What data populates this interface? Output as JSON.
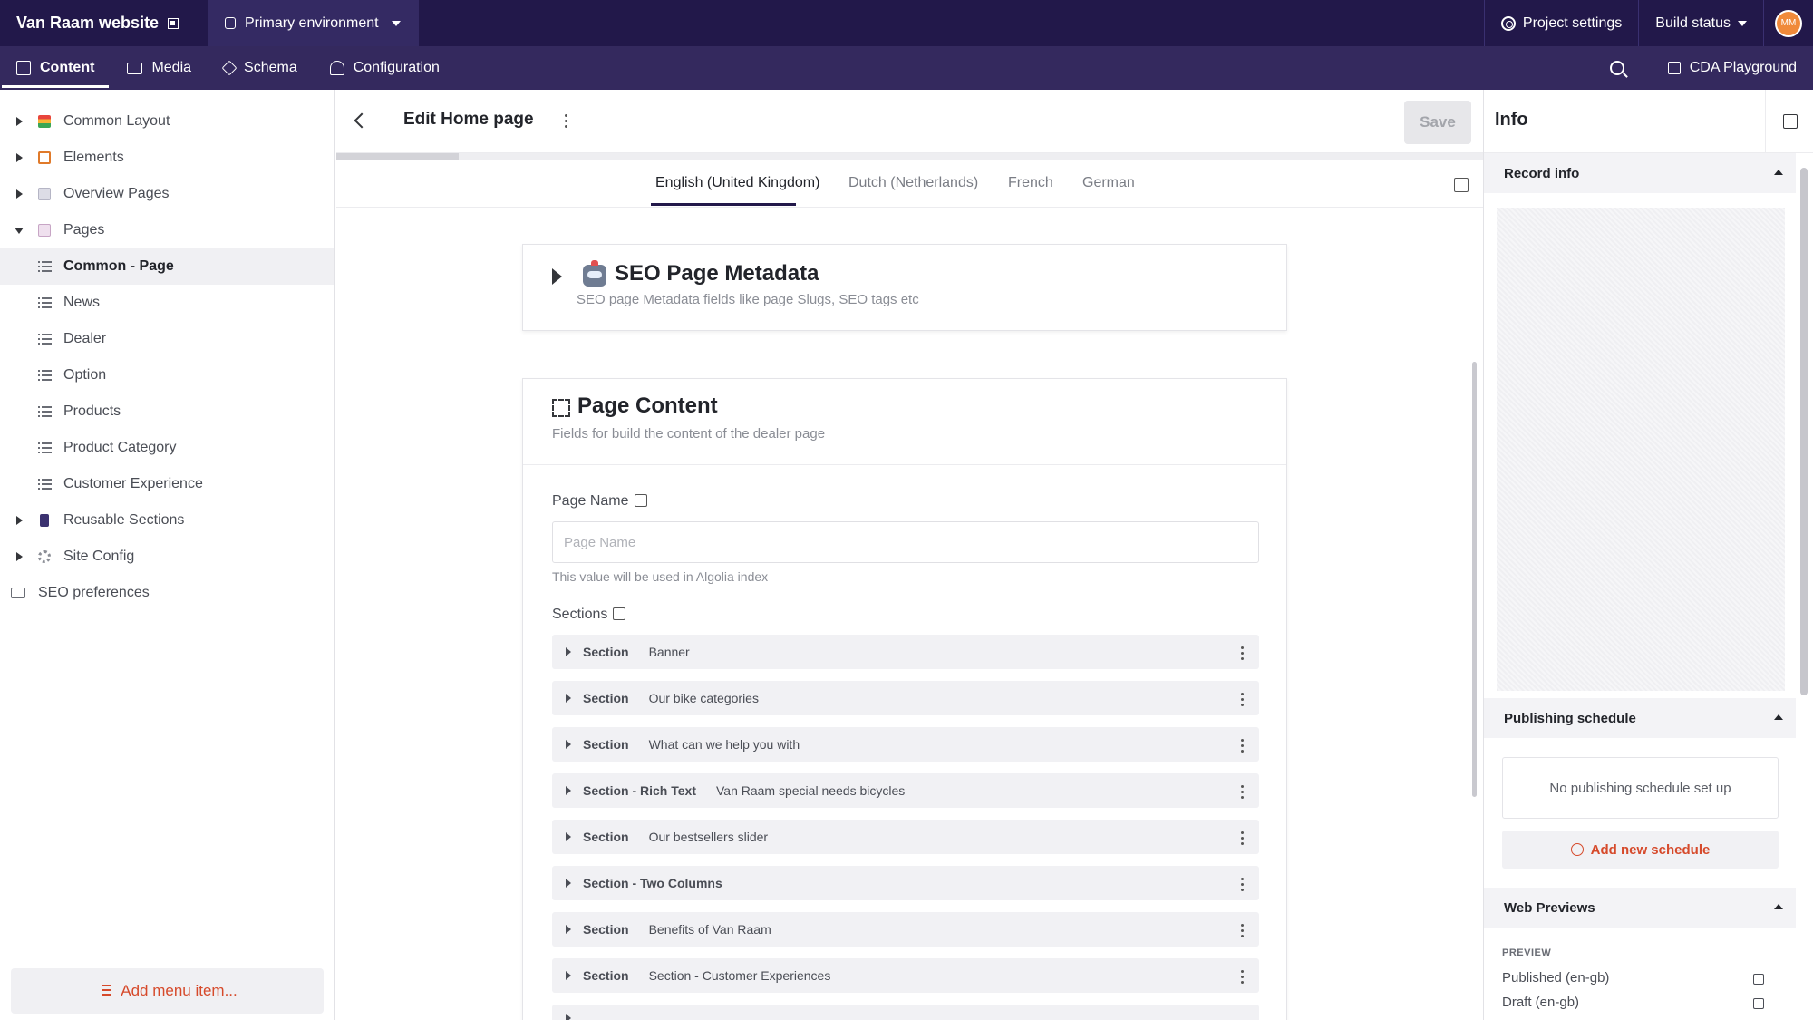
{
  "app": {
    "project_name": "Van Raam website",
    "environment": "Primary environment",
    "project_settings": "Project settings",
    "build_status": "Build status",
    "avatar_initials": "MM"
  },
  "nav": {
    "tabs": [
      {
        "label": "Content",
        "icon": "edit-icon",
        "active": true
      },
      {
        "label": "Media",
        "icon": "image-icon"
      },
      {
        "label": "Schema",
        "icon": "layers-icon"
      },
      {
        "label": "Configuration",
        "icon": "tools-icon"
      }
    ],
    "cda_playground": "CDA Playground"
  },
  "sidebar": {
    "groups": [
      {
        "label": "Common Layout",
        "icon": "rainbow-icon",
        "expanded": false
      },
      {
        "label": "Elements",
        "icon": "elements-icon",
        "expanded": false
      },
      {
        "label": "Overview Pages",
        "icon": "page-icon",
        "expanded": false
      },
      {
        "label": "Pages",
        "icon": "page-icon",
        "expanded": true
      }
    ],
    "page_models": [
      {
        "label": "Common - Page",
        "active": true
      },
      {
        "label": "News"
      },
      {
        "label": "Dealer"
      },
      {
        "label": "Option"
      },
      {
        "label": "Products"
      },
      {
        "label": "Product Category"
      },
      {
        "label": "Customer Experience"
      }
    ],
    "more_groups": [
      {
        "label": "Reusable Sections",
        "icon": "phone-icon"
      },
      {
        "label": "Site Config",
        "icon": "gear-icon"
      }
    ],
    "seo_preferences": "SEO preferences",
    "add_menu_item": "Add menu item..."
  },
  "editor": {
    "title": "Edit Home page",
    "save_label": "Save",
    "locales": [
      "English (United Kingdom)",
      "Dutch (Netherlands)",
      "French",
      "German"
    ],
    "active_locale": "English (United Kingdom)",
    "seo_card": {
      "title": "SEO Page Metadata",
      "subtitle": "SEO page Metadata fields like page Slugs, SEO tags etc"
    },
    "content_card": {
      "title": "Page Content",
      "subtitle": "Fields for build the content of the dealer page",
      "page_name_label": "Page Name",
      "page_name_placeholder": "Page Name",
      "page_name_value": "",
      "page_name_hint": "This value will be used in Algolia index",
      "sections_label": "Sections",
      "sections": [
        {
          "type": "Section",
          "name": "Banner"
        },
        {
          "type": "Section",
          "name": "Our bike categories"
        },
        {
          "type": "Section",
          "name": "What can we help you with"
        },
        {
          "type": "Section - Rich Text",
          "name": "Van Raam special needs bicycles"
        },
        {
          "type": "Section",
          "name": "Our bestsellers slider"
        },
        {
          "type": "Section - Two Columns",
          "name": ""
        },
        {
          "type": "Section",
          "name": "Benefits of Van Raam"
        },
        {
          "type": "Section",
          "name": "Section - Customer Experiences"
        }
      ]
    }
  },
  "info_panel": {
    "title": "Info",
    "record_info": "Record info",
    "publishing_schedule": "Publishing schedule",
    "no_schedule": "No publishing schedule set up",
    "add_schedule": "Add new schedule",
    "web_previews": "Web Previews",
    "preview_label": "PREVIEW",
    "preview_links": [
      "Published (en-gb)",
      "Draft (en-gb)"
    ]
  },
  "colors": {
    "topbar": "#22184a",
    "navbar": "#34295e",
    "accent": "#d64a2b"
  }
}
